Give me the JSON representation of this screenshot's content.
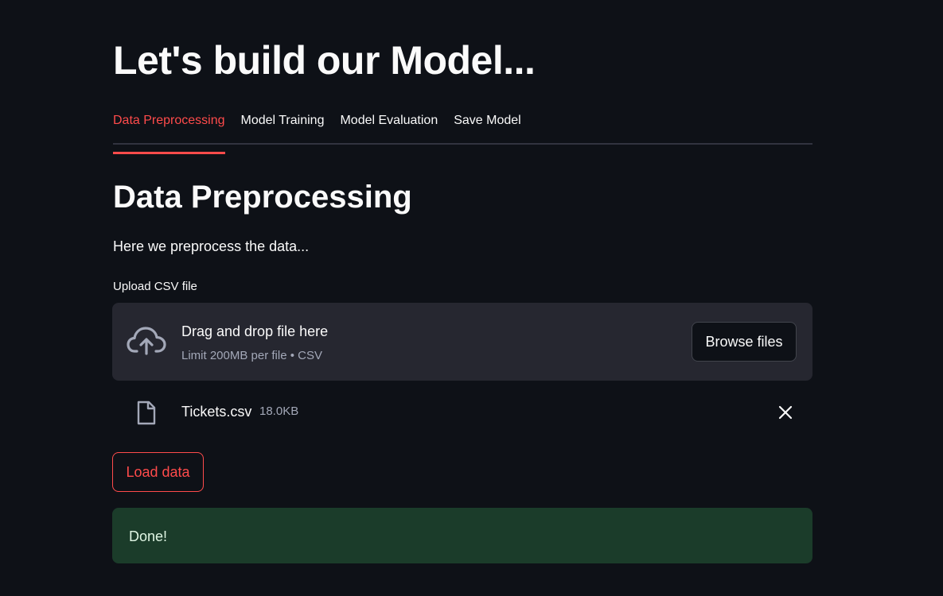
{
  "header": {
    "title": "Let's build our Model..."
  },
  "tabs": [
    {
      "label": "Data Preprocessing",
      "active": true
    },
    {
      "label": "Model Training",
      "active": false
    },
    {
      "label": "Model Evaluation",
      "active": false
    },
    {
      "label": "Save Model",
      "active": false
    }
  ],
  "section": {
    "title": "Data Preprocessing",
    "description": "Here we preprocess the data..."
  },
  "uploader": {
    "label": "Upload CSV file",
    "drop_text": "Drag and drop file here",
    "limit_text": "Limit 200MB per file • CSV",
    "browse_label": "Browse files",
    "icon": "cloud-upload-icon"
  },
  "file": {
    "name": "Tickets.csv",
    "size": "18.0KB",
    "icon": "file-icon",
    "remove_icon": "close-icon"
  },
  "actions": {
    "load_label": "Load data"
  },
  "status": {
    "message": "Done!"
  },
  "colors": {
    "background": "#0e1117",
    "accent": "#ff4b4b",
    "dropzone_bg": "#262730",
    "success_bg": "#1b3c2a"
  }
}
